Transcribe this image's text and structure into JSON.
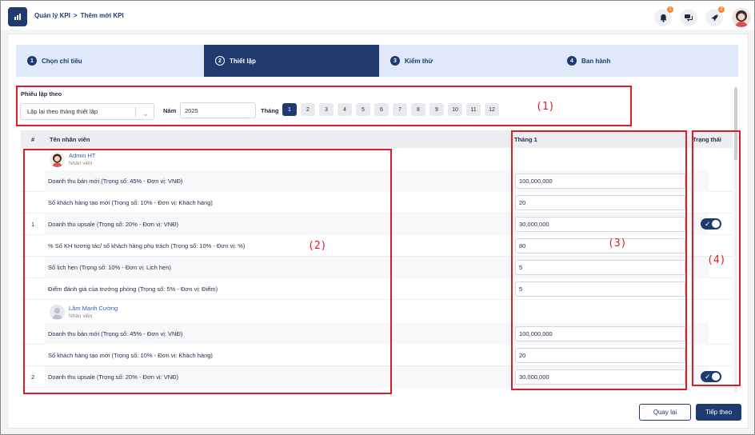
{
  "breadcrumb": {
    "root": "Quản lý KPI",
    "separator": ">",
    "current": "Thêm mới KPI"
  },
  "header": {
    "notification_count": "1",
    "rocket_count": "2"
  },
  "steps": [
    {
      "num": "1",
      "label": "Chọn chỉ tiêu"
    },
    {
      "num": "2",
      "label": "Thiết lập"
    },
    {
      "num": "3",
      "label": "Kiểm thử"
    },
    {
      "num": "4",
      "label": "Ban hành"
    }
  ],
  "filter": {
    "title": "Phiếu lập theo",
    "select_value": "Lặp lại theo tháng thiết lập",
    "year_label": "Năm",
    "year_value": "2025",
    "month_label": "Tháng",
    "months": [
      "1",
      "2",
      "3",
      "4",
      "5",
      "6",
      "7",
      "8",
      "9",
      "10",
      "11",
      "12"
    ],
    "selected_month": "1"
  },
  "table": {
    "headers": {
      "index": "#",
      "employee": "Tên nhân viên",
      "month": "Tháng 1",
      "status": "Trạng thái"
    },
    "employees": [
      {
        "index": "1",
        "name": "Admin HT",
        "role": "Nhân viên",
        "status_on": true,
        "kpis": [
          {
            "label": "Doanh thu bán mới (Trọng số: 45% - Đơn vị: VNĐ)",
            "value": "100,000,000"
          },
          {
            "label": "Số khách hàng tạo mới (Trọng số: 10% - Đơn vị: Khách hàng)",
            "value": "20"
          },
          {
            "label": "Doanh thu upsale (Trọng số: 20% - Đơn vị: VNĐ)",
            "value": "30,000,000"
          },
          {
            "label": "% Số KH tương tác/ số khách hàng phụ trách (Trọng số: 10% - Đơn vị: %)",
            "value": "80"
          },
          {
            "label": "Số lịch hẹn (Trọng số: 10% - Đơn vị: Lịch hẹn)",
            "value": "5"
          },
          {
            "label": "Điểm đánh giá của trưởng phòng (Trọng số: 5% - Đơn vị: Điểm)",
            "value": "5"
          }
        ]
      },
      {
        "index": "2",
        "name": "Lâm Mạnh Cường",
        "role": "Nhân viên",
        "status_on": true,
        "kpis": [
          {
            "label": "Doanh thu bán mới (Trọng số: 45% - Đơn vị: VNĐ)",
            "value": "100,000,000"
          },
          {
            "label": "Số khách hàng tạo mới (Trọng số: 10% - Đơn vị: Khách hàng)",
            "value": "20"
          },
          {
            "label": "Doanh thu upsale (Trọng số: 20% - Đơn vị: VNĐ)",
            "value": "30,000,000"
          }
        ]
      }
    ]
  },
  "annotations": [
    "(1)",
    "(2)",
    "(3)",
    "(4)"
  ],
  "footer": {
    "back_label": "Quay lại",
    "next_label": "Tiếp theo"
  },
  "colors": {
    "primary": "#1e3a6e",
    "stepper_bg": "#dfe9fa",
    "annotation": "#e01b24",
    "badge": "#f08a3c"
  }
}
